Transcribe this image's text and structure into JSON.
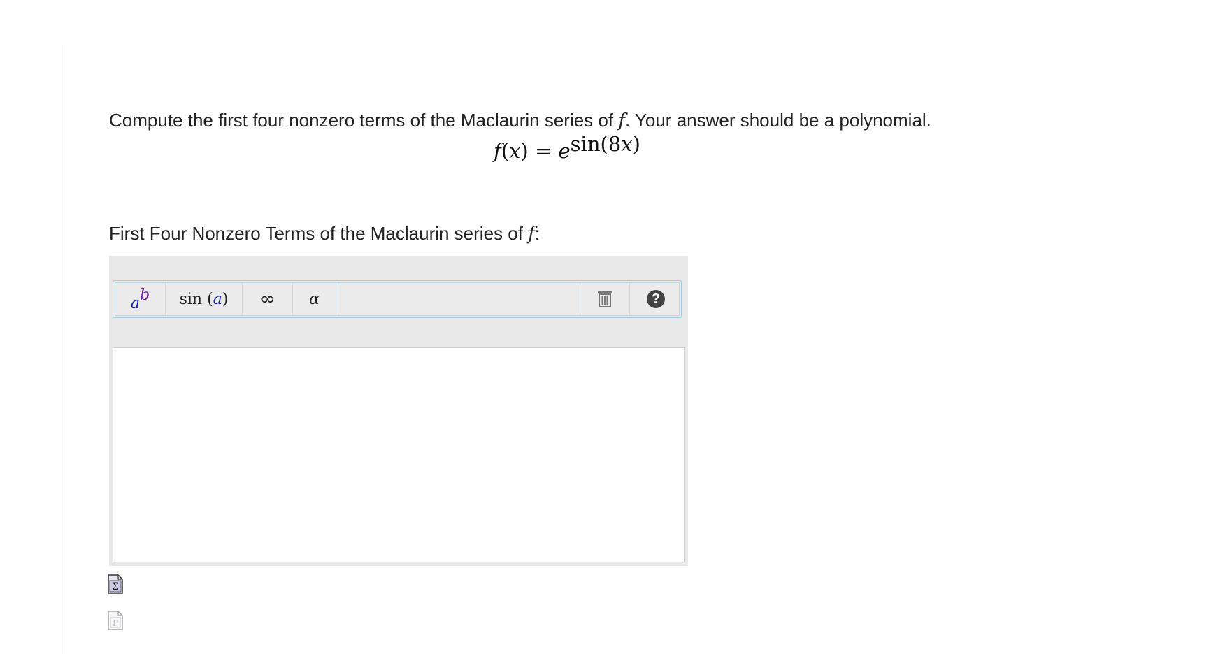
{
  "question": {
    "prompt_before_var": "Compute the first four nonzero terms of the Maclaurin series of ",
    "prompt_var": "f",
    "prompt_after_var": ". Your answer should be a polynomial."
  },
  "formula": {
    "lhs_func": "f",
    "lhs_open": "(",
    "lhs_var": "x",
    "lhs_close": ")",
    "equals": " = ",
    "base": "e",
    "exp_func": "sin",
    "exp_open": "(8",
    "exp_var": "x",
    "exp_close": ")"
  },
  "answer": {
    "label_text": "First Four Nonzero Terms of the Maclaurin series of ",
    "label_var": "f",
    "label_colon": ":",
    "value": ""
  },
  "toolbar": {
    "exponent_base": "a",
    "exponent_power": "b",
    "sin_func": "sin ",
    "sin_open": "(",
    "sin_arg": "a",
    "sin_close": ")",
    "infinity": "∞",
    "alpha": "α",
    "help_symbol": "?"
  },
  "icons": {
    "trash": "trash-icon",
    "help": "help-icon",
    "equation_file": "equation-file-icon",
    "preview_file": "preview-file-icon"
  },
  "colors": {
    "accent_blue": "#1a2aa8",
    "accent_purple": "#7a1aa0",
    "panel_gray": "#e8e8e8",
    "toolbar_border": "#a9cde0"
  }
}
